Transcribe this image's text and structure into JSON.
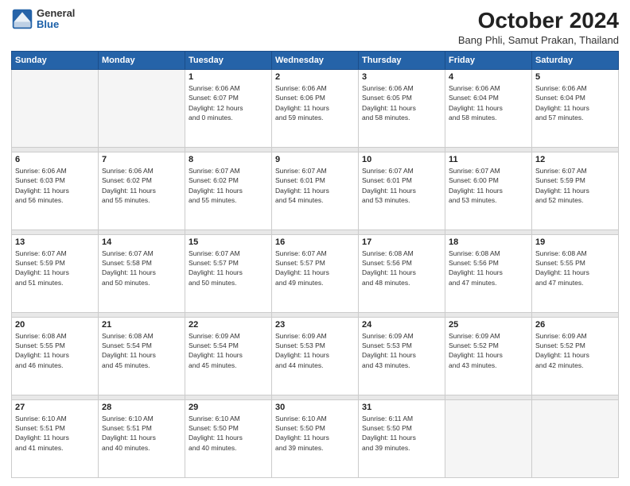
{
  "logo": {
    "general": "General",
    "blue": "Blue"
  },
  "header": {
    "month": "October 2024",
    "location": "Bang Phli, Samut Prakan, Thailand"
  },
  "weekdays": [
    "Sunday",
    "Monday",
    "Tuesday",
    "Wednesday",
    "Thursday",
    "Friday",
    "Saturday"
  ],
  "weeks": [
    [
      {
        "day": "",
        "info": ""
      },
      {
        "day": "",
        "info": ""
      },
      {
        "day": "1",
        "info": "Sunrise: 6:06 AM\nSunset: 6:07 PM\nDaylight: 12 hours\nand 0 minutes."
      },
      {
        "day": "2",
        "info": "Sunrise: 6:06 AM\nSunset: 6:06 PM\nDaylight: 11 hours\nand 59 minutes."
      },
      {
        "day": "3",
        "info": "Sunrise: 6:06 AM\nSunset: 6:05 PM\nDaylight: 11 hours\nand 58 minutes."
      },
      {
        "day": "4",
        "info": "Sunrise: 6:06 AM\nSunset: 6:04 PM\nDaylight: 11 hours\nand 58 minutes."
      },
      {
        "day": "5",
        "info": "Sunrise: 6:06 AM\nSunset: 6:04 PM\nDaylight: 11 hours\nand 57 minutes."
      }
    ],
    [
      {
        "day": "6",
        "info": "Sunrise: 6:06 AM\nSunset: 6:03 PM\nDaylight: 11 hours\nand 56 minutes."
      },
      {
        "day": "7",
        "info": "Sunrise: 6:06 AM\nSunset: 6:02 PM\nDaylight: 11 hours\nand 55 minutes."
      },
      {
        "day": "8",
        "info": "Sunrise: 6:07 AM\nSunset: 6:02 PM\nDaylight: 11 hours\nand 55 minutes."
      },
      {
        "day": "9",
        "info": "Sunrise: 6:07 AM\nSunset: 6:01 PM\nDaylight: 11 hours\nand 54 minutes."
      },
      {
        "day": "10",
        "info": "Sunrise: 6:07 AM\nSunset: 6:01 PM\nDaylight: 11 hours\nand 53 minutes."
      },
      {
        "day": "11",
        "info": "Sunrise: 6:07 AM\nSunset: 6:00 PM\nDaylight: 11 hours\nand 53 minutes."
      },
      {
        "day": "12",
        "info": "Sunrise: 6:07 AM\nSunset: 5:59 PM\nDaylight: 11 hours\nand 52 minutes."
      }
    ],
    [
      {
        "day": "13",
        "info": "Sunrise: 6:07 AM\nSunset: 5:59 PM\nDaylight: 11 hours\nand 51 minutes."
      },
      {
        "day": "14",
        "info": "Sunrise: 6:07 AM\nSunset: 5:58 PM\nDaylight: 11 hours\nand 50 minutes."
      },
      {
        "day": "15",
        "info": "Sunrise: 6:07 AM\nSunset: 5:57 PM\nDaylight: 11 hours\nand 50 minutes."
      },
      {
        "day": "16",
        "info": "Sunrise: 6:07 AM\nSunset: 5:57 PM\nDaylight: 11 hours\nand 49 minutes."
      },
      {
        "day": "17",
        "info": "Sunrise: 6:08 AM\nSunset: 5:56 PM\nDaylight: 11 hours\nand 48 minutes."
      },
      {
        "day": "18",
        "info": "Sunrise: 6:08 AM\nSunset: 5:56 PM\nDaylight: 11 hours\nand 47 minutes."
      },
      {
        "day": "19",
        "info": "Sunrise: 6:08 AM\nSunset: 5:55 PM\nDaylight: 11 hours\nand 47 minutes."
      }
    ],
    [
      {
        "day": "20",
        "info": "Sunrise: 6:08 AM\nSunset: 5:55 PM\nDaylight: 11 hours\nand 46 minutes."
      },
      {
        "day": "21",
        "info": "Sunrise: 6:08 AM\nSunset: 5:54 PM\nDaylight: 11 hours\nand 45 minutes."
      },
      {
        "day": "22",
        "info": "Sunrise: 6:09 AM\nSunset: 5:54 PM\nDaylight: 11 hours\nand 45 minutes."
      },
      {
        "day": "23",
        "info": "Sunrise: 6:09 AM\nSunset: 5:53 PM\nDaylight: 11 hours\nand 44 minutes."
      },
      {
        "day": "24",
        "info": "Sunrise: 6:09 AM\nSunset: 5:53 PM\nDaylight: 11 hours\nand 43 minutes."
      },
      {
        "day": "25",
        "info": "Sunrise: 6:09 AM\nSunset: 5:52 PM\nDaylight: 11 hours\nand 43 minutes."
      },
      {
        "day": "26",
        "info": "Sunrise: 6:09 AM\nSunset: 5:52 PM\nDaylight: 11 hours\nand 42 minutes."
      }
    ],
    [
      {
        "day": "27",
        "info": "Sunrise: 6:10 AM\nSunset: 5:51 PM\nDaylight: 11 hours\nand 41 minutes."
      },
      {
        "day": "28",
        "info": "Sunrise: 6:10 AM\nSunset: 5:51 PM\nDaylight: 11 hours\nand 40 minutes."
      },
      {
        "day": "29",
        "info": "Sunrise: 6:10 AM\nSunset: 5:50 PM\nDaylight: 11 hours\nand 40 minutes."
      },
      {
        "day": "30",
        "info": "Sunrise: 6:10 AM\nSunset: 5:50 PM\nDaylight: 11 hours\nand 39 minutes."
      },
      {
        "day": "31",
        "info": "Sunrise: 6:11 AM\nSunset: 5:50 PM\nDaylight: 11 hours\nand 39 minutes."
      },
      {
        "day": "",
        "info": ""
      },
      {
        "day": "",
        "info": ""
      }
    ]
  ]
}
